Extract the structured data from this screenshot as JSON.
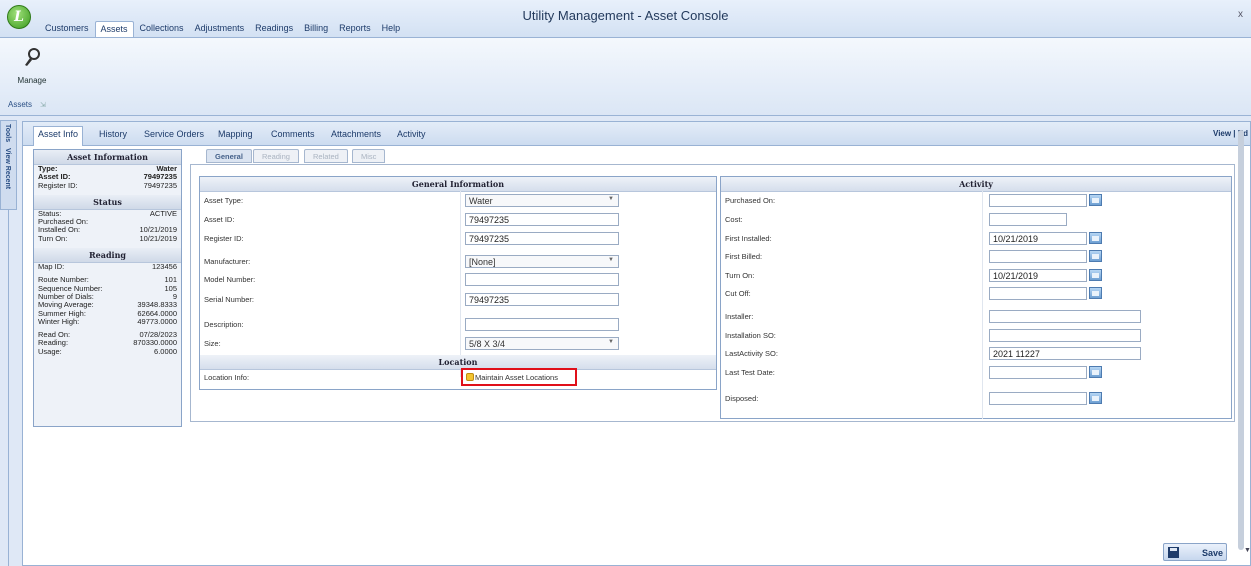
{
  "window": {
    "title": "Utility Management - Asset Console",
    "close": "x",
    "logo": "L"
  },
  "menu": [
    {
      "label": "Customers"
    },
    {
      "label": "Assets",
      "active": true
    },
    {
      "label": "Collections"
    },
    {
      "label": "Adjustments"
    },
    {
      "label": "Readings"
    },
    {
      "label": "Billing"
    },
    {
      "label": "Reports"
    },
    {
      "label": "Help"
    }
  ],
  "ribbon": {
    "manage_label": "Manage",
    "manage_icon": "edit-pen-icon",
    "group_label": "Assets"
  },
  "side_tabs": {
    "tools": "Tools",
    "view_recent": "View Recent"
  },
  "top_tabs": [
    "Asset Info",
    "History",
    "Service Orders",
    "Mapping",
    "Comments",
    "Attachments",
    "Activity"
  ],
  "view_edit": "View | Ed",
  "summary": {
    "asset_header": "Asset Information",
    "type_label": "Type:",
    "type": "Water",
    "asset_id_label": "Asset ID:",
    "asset_id": "79497235",
    "register_id_label": "Register ID:",
    "register_id": "79497235",
    "status_header": "Status",
    "status_label": "Status:",
    "status": "ACTIVE",
    "purchased_label": "Purchased On:",
    "purchased": "",
    "installed_label": "Installed On:",
    "installed": "10/21/2019",
    "turn_on_label": "Turn On:",
    "turn_on": "10/21/2019",
    "reading_header": "Reading",
    "map_id_label": "Map ID:",
    "map_id": "123456",
    "route_label": "Route Number:",
    "route": "101",
    "sequence_label": "Sequence Number:",
    "sequence": "105",
    "dials_label": "Number of Dials:",
    "dials": "9",
    "moving_avg_label": "Moving Average:",
    "moving_avg": "39348.8333",
    "summer_label": "Summer High:",
    "summer": "62664.0000",
    "winter_label": "Winter High:",
    "winter": "49773.0000",
    "read_on_label": "Read On:",
    "read_on": "07/28/2023",
    "reading_label": "Reading:",
    "reading": "870330.0000",
    "usage_label": "Usage:",
    "usage": "6.0000"
  },
  "sub_tabs": [
    "General",
    "Reading",
    "Related",
    "Misc"
  ],
  "general": {
    "header": "General Information",
    "asset_type_label": "Asset Type:",
    "asset_type": "Water",
    "asset_id_label": "Asset ID:",
    "asset_id": "79497235",
    "register_id_label": "Register ID:",
    "register_id": "79497235",
    "manufacturer_label": "Manufacturer:",
    "manufacturer": "[None]",
    "model_label": "Model Number:",
    "model": "",
    "serial_label": "Serial Number:",
    "serial": "79497235",
    "description_label": "Description:",
    "description": "",
    "size_label": "Size:",
    "size": "5/8 X 3/4",
    "location_header": "Location",
    "location_info_label": "Location Info:",
    "maintain_label": "Maintain Asset Locations"
  },
  "activity": {
    "header": "Activity",
    "purchased_label": "Purchased On:",
    "purchased": "",
    "cost_label": "Cost:",
    "cost": "",
    "first_installed_label": "First Installed:",
    "first_installed": "10/21/2019",
    "first_billed_label": "First Billed:",
    "first_billed": "",
    "turn_on_label": "Turn On:",
    "turn_on": "10/21/2019",
    "cut_off_label": "Cut Off:",
    "cut_off": "",
    "installer_label": "Installer:",
    "installer": "",
    "installation_so_label": "Installation SO:",
    "installation_so": "",
    "last_activity_label": "LastActivity SO:",
    "last_activity": "2021 11227",
    "last_test_label": "Last Test Date:",
    "last_test": "",
    "disposed_label": "Disposed:",
    "disposed": ""
  },
  "save_label": "Save",
  "colors": {
    "highlight": "#e0101a",
    "chrome": "#dfe8f6"
  }
}
